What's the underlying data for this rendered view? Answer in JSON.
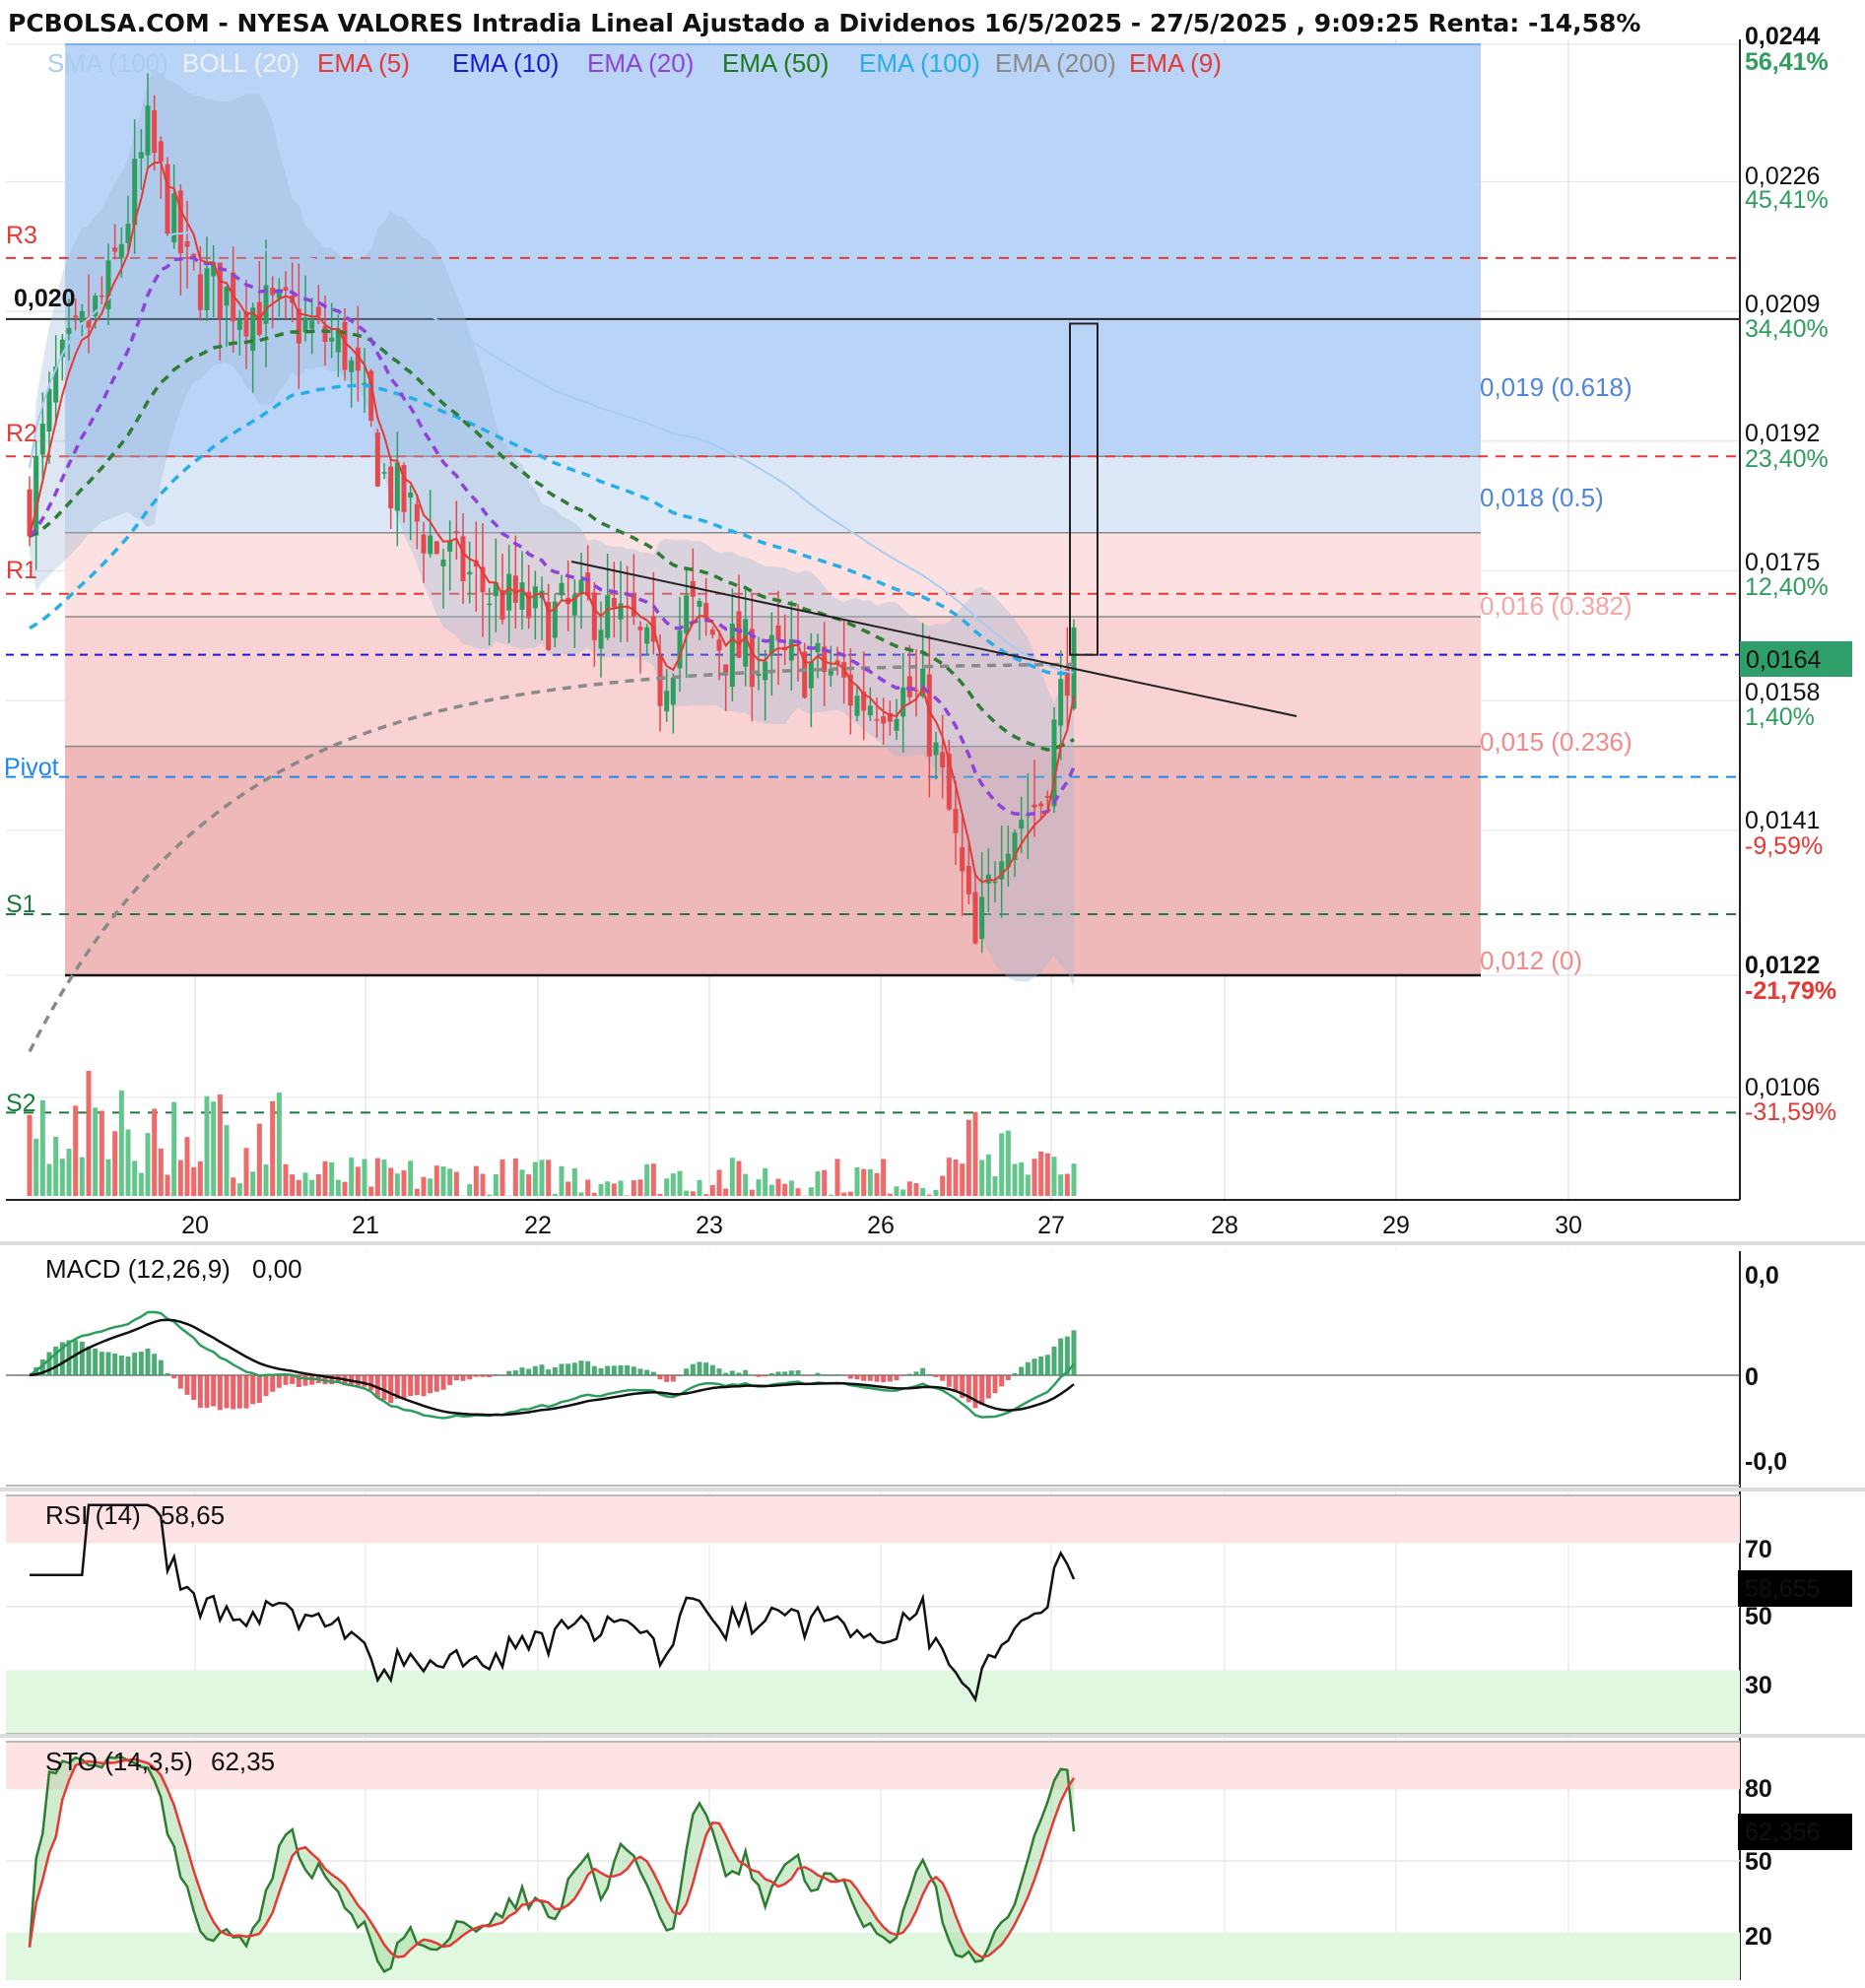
{
  "title": "PCBOLSA.COM - NYESA VALORES Intradia Lineal Ajustado a Dividenos 16/5/2025 - 27/5/2025 , 9:09:25 Renta: -14,58%",
  "colors": {
    "up": "#2e9e5e",
    "down": "#e5484d",
    "fib_blue": "#4f86d9",
    "fib_pink": "#f08b8b",
    "pos_pct": "#2e9e5e",
    "neg_pct": "#e53935",
    "current_box": "#2e9e6a"
  },
  "chart_data": [
    {
      "type": "candlestick",
      "title": "PCBOLSA.COM - NYESA VALORES Intradia Lineal Ajustado a Dividenos 16/5/2025 - 27/5/2025 , 9:09:25 Renta: -14,58%",
      "legend": [
        {
          "name": "SMA (100)",
          "color": "#a9cdf0"
        },
        {
          "name": "BOLL (20)",
          "color": "#eef2f8"
        },
        {
          "name": "EMA (5)",
          "color": "#e53935"
        },
        {
          "name": "EMA (10)",
          "color": "#1a1ad6"
        },
        {
          "name": "EMA (20)",
          "color": "#8e44d8"
        },
        {
          "name": "EMA (50)",
          "color": "#1f7a1f"
        },
        {
          "name": "EMA (100)",
          "color": "#27aee8"
        },
        {
          "name": "EMA (200)",
          "color": "#8a8a8a"
        },
        {
          "name": "EMA (9)",
          "color": "#e53935"
        }
      ],
      "x_ticks": [
        "20",
        "21",
        "22",
        "23",
        "26",
        "27",
        "28",
        "29",
        "30"
      ],
      "y_ticks": [
        {
          "value": 0.0244,
          "label": "0,0244",
          "pct": "56,41%",
          "bold": true
        },
        {
          "value": 0.0226,
          "label": "0,0226",
          "pct": "45,41%",
          "bold": false
        },
        {
          "value": 0.0209,
          "label": "0,0209",
          "pct": "34,40%",
          "bold": false
        },
        {
          "value": 0.0192,
          "label": "0,0192",
          "pct": "23,40%",
          "bold": false
        },
        {
          "value": 0.0175,
          "label": "0,0175",
          "pct": "12,40%",
          "bold": false
        },
        {
          "value": 0.0158,
          "label": "0,0158",
          "pct": "1,40%",
          "bold": false
        },
        {
          "value": 0.0141,
          "label": "0,0141",
          "pct": "-9,59%",
          "bold": false
        },
        {
          "value": 0.0122,
          "label": "0,0122",
          "pct": "-21,79%",
          "bold": true
        },
        {
          "value": 0.0106,
          "label": "0,0106",
          "pct": "-31,59%",
          "bold": false
        }
      ],
      "ylim": [
        0.0096,
        0.0244
      ],
      "current_price": {
        "value": 0.0164,
        "label": "0,0164"
      },
      "fibonacci": [
        {
          "value": 0.019,
          "label": "0,019 (0.618)",
          "color": "#4f86d9"
        },
        {
          "value": 0.018,
          "label": "0,018 (0.5)",
          "color": "#4f86d9"
        },
        {
          "value": 0.016,
          "label": "0,016 (0.382)",
          "color": "#f08b8b"
        },
        {
          "value": 0.015,
          "label": "0,015 (0.236)",
          "color": "#f08b8b"
        },
        {
          "value": 0.012,
          "label": "0,012 (0)",
          "color": "#f08b8b"
        }
      ],
      "fib_high": {
        "value": 0.0244
      },
      "fib_low": {
        "value": 0.0122
      },
      "pivots": [
        {
          "name": "R3",
          "value": 0.0216,
          "color": "#e53935"
        },
        {
          "name": "R2",
          "value": 0.019,
          "color": "#e53935"
        },
        {
          "name": "R1",
          "value": 0.0172,
          "color": "#e53935"
        },
        {
          "name": "Pivot",
          "value": 0.0148,
          "color": "#1e88e5"
        },
        {
          "name": "S1",
          "value": 0.013,
          "color": "#1b7a3e"
        },
        {
          "name": "S2",
          "value": 0.0104,
          "color": "#1b7a3e"
        }
      ],
      "level_line": {
        "value": 0.0208,
        "label": "0,020"
      },
      "trendline": [
        {
          "x": 0.33,
          "y": 0.01734
        },
        {
          "x": 0.74,
          "y": 0.01593
        }
      ],
      "candles_count": 160
    },
    {
      "type": "line",
      "name": "MACD (12,26,9)",
      "current": "0,00",
      "y_ticks": [
        {
          "label": "0,0",
          "color": "#e53935"
        },
        {
          "label": "0",
          "color": "#111111"
        },
        {
          "label": "-0,0",
          "color": "#1f7a1f"
        }
      ]
    },
    {
      "type": "line",
      "name": "RSI (14)",
      "current": "58,65",
      "current_box": "58,655",
      "y_ticks": [
        {
          "value": 70,
          "label": "70",
          "color": "#e53935"
        },
        {
          "value": 50,
          "label": "50",
          "color": "#111111"
        },
        {
          "value": 30,
          "label": "30",
          "color": "#1f7a1f"
        }
      ],
      "ylim": [
        10,
        85
      ]
    },
    {
      "type": "line",
      "name": "STO (14,3,5)",
      "current": "62,35",
      "current_box": "62,356",
      "y_ticks": [
        {
          "value": 80,
          "label": "80",
          "color": "#e53935"
        },
        {
          "value": 50,
          "label": "50",
          "color": "#111111"
        },
        {
          "value": 20,
          "label": "20",
          "color": "#1f7a1f"
        }
      ],
      "ylim": [
        0,
        100
      ]
    }
  ]
}
